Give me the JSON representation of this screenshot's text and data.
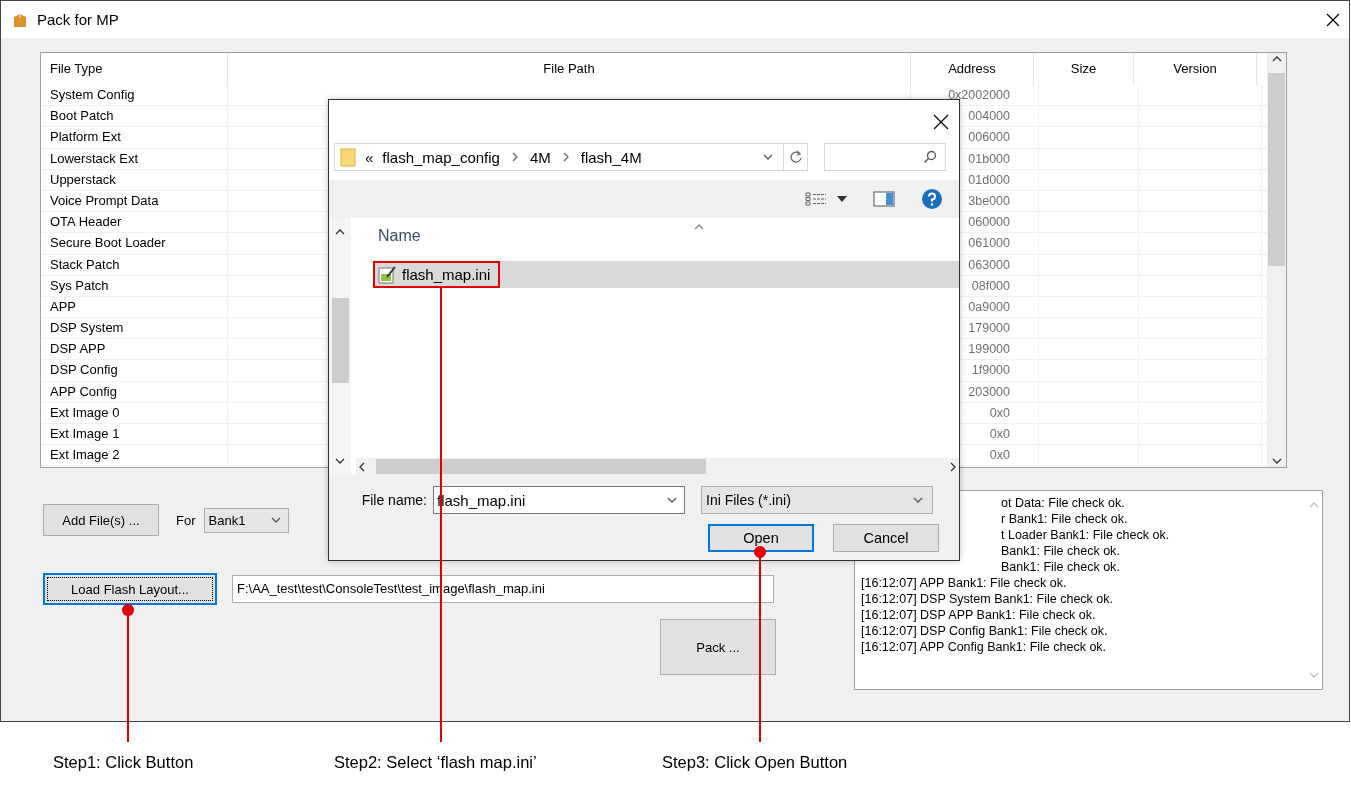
{
  "window": {
    "title": "Pack for MP"
  },
  "table": {
    "columns": [
      "File Type",
      "File Path",
      "Address",
      "Size",
      "Version"
    ],
    "rows": [
      {
        "file_type": "System Config",
        "address": "0x2002000"
      },
      {
        "file_type": "Boot Patch",
        "address": "004000"
      },
      {
        "file_type": "Platform Ext",
        "address": "006000"
      },
      {
        "file_type": "Lowerstack Ext",
        "address": "01b000"
      },
      {
        "file_type": "Upperstack",
        "address": "01d000"
      },
      {
        "file_type": "Voice Prompt Data",
        "address": "3be000"
      },
      {
        "file_type": "OTA Header",
        "address": "060000"
      },
      {
        "file_type": "Secure Boot Loader",
        "address": "061000"
      },
      {
        "file_type": "Stack Patch",
        "address": "063000"
      },
      {
        "file_type": "Sys Patch",
        "address": "08f000"
      },
      {
        "file_type": "APP",
        "address": "0a9000"
      },
      {
        "file_type": "DSP System",
        "address": "179000"
      },
      {
        "file_type": "DSP APP",
        "address": "199000"
      },
      {
        "file_type": "DSP Config",
        "address": "1f9000"
      },
      {
        "file_type": "APP Config",
        "address": "203000"
      },
      {
        "file_type": "Ext Image 0",
        "address": "0x0"
      },
      {
        "file_type": "Ext Image 1",
        "address": "0x0"
      },
      {
        "file_type": "Ext Image 2",
        "address": "0x0"
      }
    ]
  },
  "add_files_button": "Add File(s) ...",
  "for_label": "For",
  "bank_combo": {
    "value": "Bank1"
  },
  "load_button": {
    "label": "Load Flash Layout...",
    "focused": true
  },
  "layout_path": {
    "value": "F:\\AA_test\\test\\ConsoleTest\\test_image\\flash_map.ini"
  },
  "pack_button": "Pack ...",
  "log": {
    "lines": [
      {
        "text": "ot Data: File check ok.",
        "kind": "partial"
      },
      {
        "text": "r Bank1: File check ok.",
        "kind": "partial"
      },
      {
        "text": "t Loader Bank1: File check ok.",
        "kind": "partial"
      },
      {
        "text": "Bank1: File check ok.",
        "kind": "partial"
      },
      {
        "text": "Bank1: File check ok.",
        "kind": "partial"
      },
      {
        "text": "[16:12:07] APP Bank1: File check ok.",
        "kind": "full"
      },
      {
        "text": "[16:12:07] DSP System Bank1: File check ok.",
        "kind": "full"
      },
      {
        "text": "[16:12:07] DSP APP Bank1: File check ok.",
        "kind": "full"
      },
      {
        "text": "[16:12:07] DSP Config Bank1: File check ok.",
        "kind": "full"
      },
      {
        "text": "[16:12:07] APP Config Bank1: File check ok.",
        "kind": "full"
      }
    ]
  },
  "dialog": {
    "breadcrumb": {
      "overflow": "«",
      "parts": [
        "flash_map_config",
        "4M",
        "flash_4M"
      ]
    },
    "list": {
      "header": "Name",
      "files": [
        {
          "name": "flash_map.ini",
          "selected": true
        }
      ]
    },
    "file_name": {
      "label": "File name:",
      "value": "flash_map.ini"
    },
    "file_type": {
      "value": "Ini Files (*.ini)"
    },
    "buttons": [
      {
        "label": "Open",
        "default": true
      },
      {
        "label": "Cancel",
        "default": false
      }
    ]
  },
  "annotations": [
    {
      "text": "Step1: Click Button"
    },
    {
      "text": "Step2: Select ‘flash map.ini’"
    },
    {
      "text": "Step3: Click Open Button"
    }
  ]
}
